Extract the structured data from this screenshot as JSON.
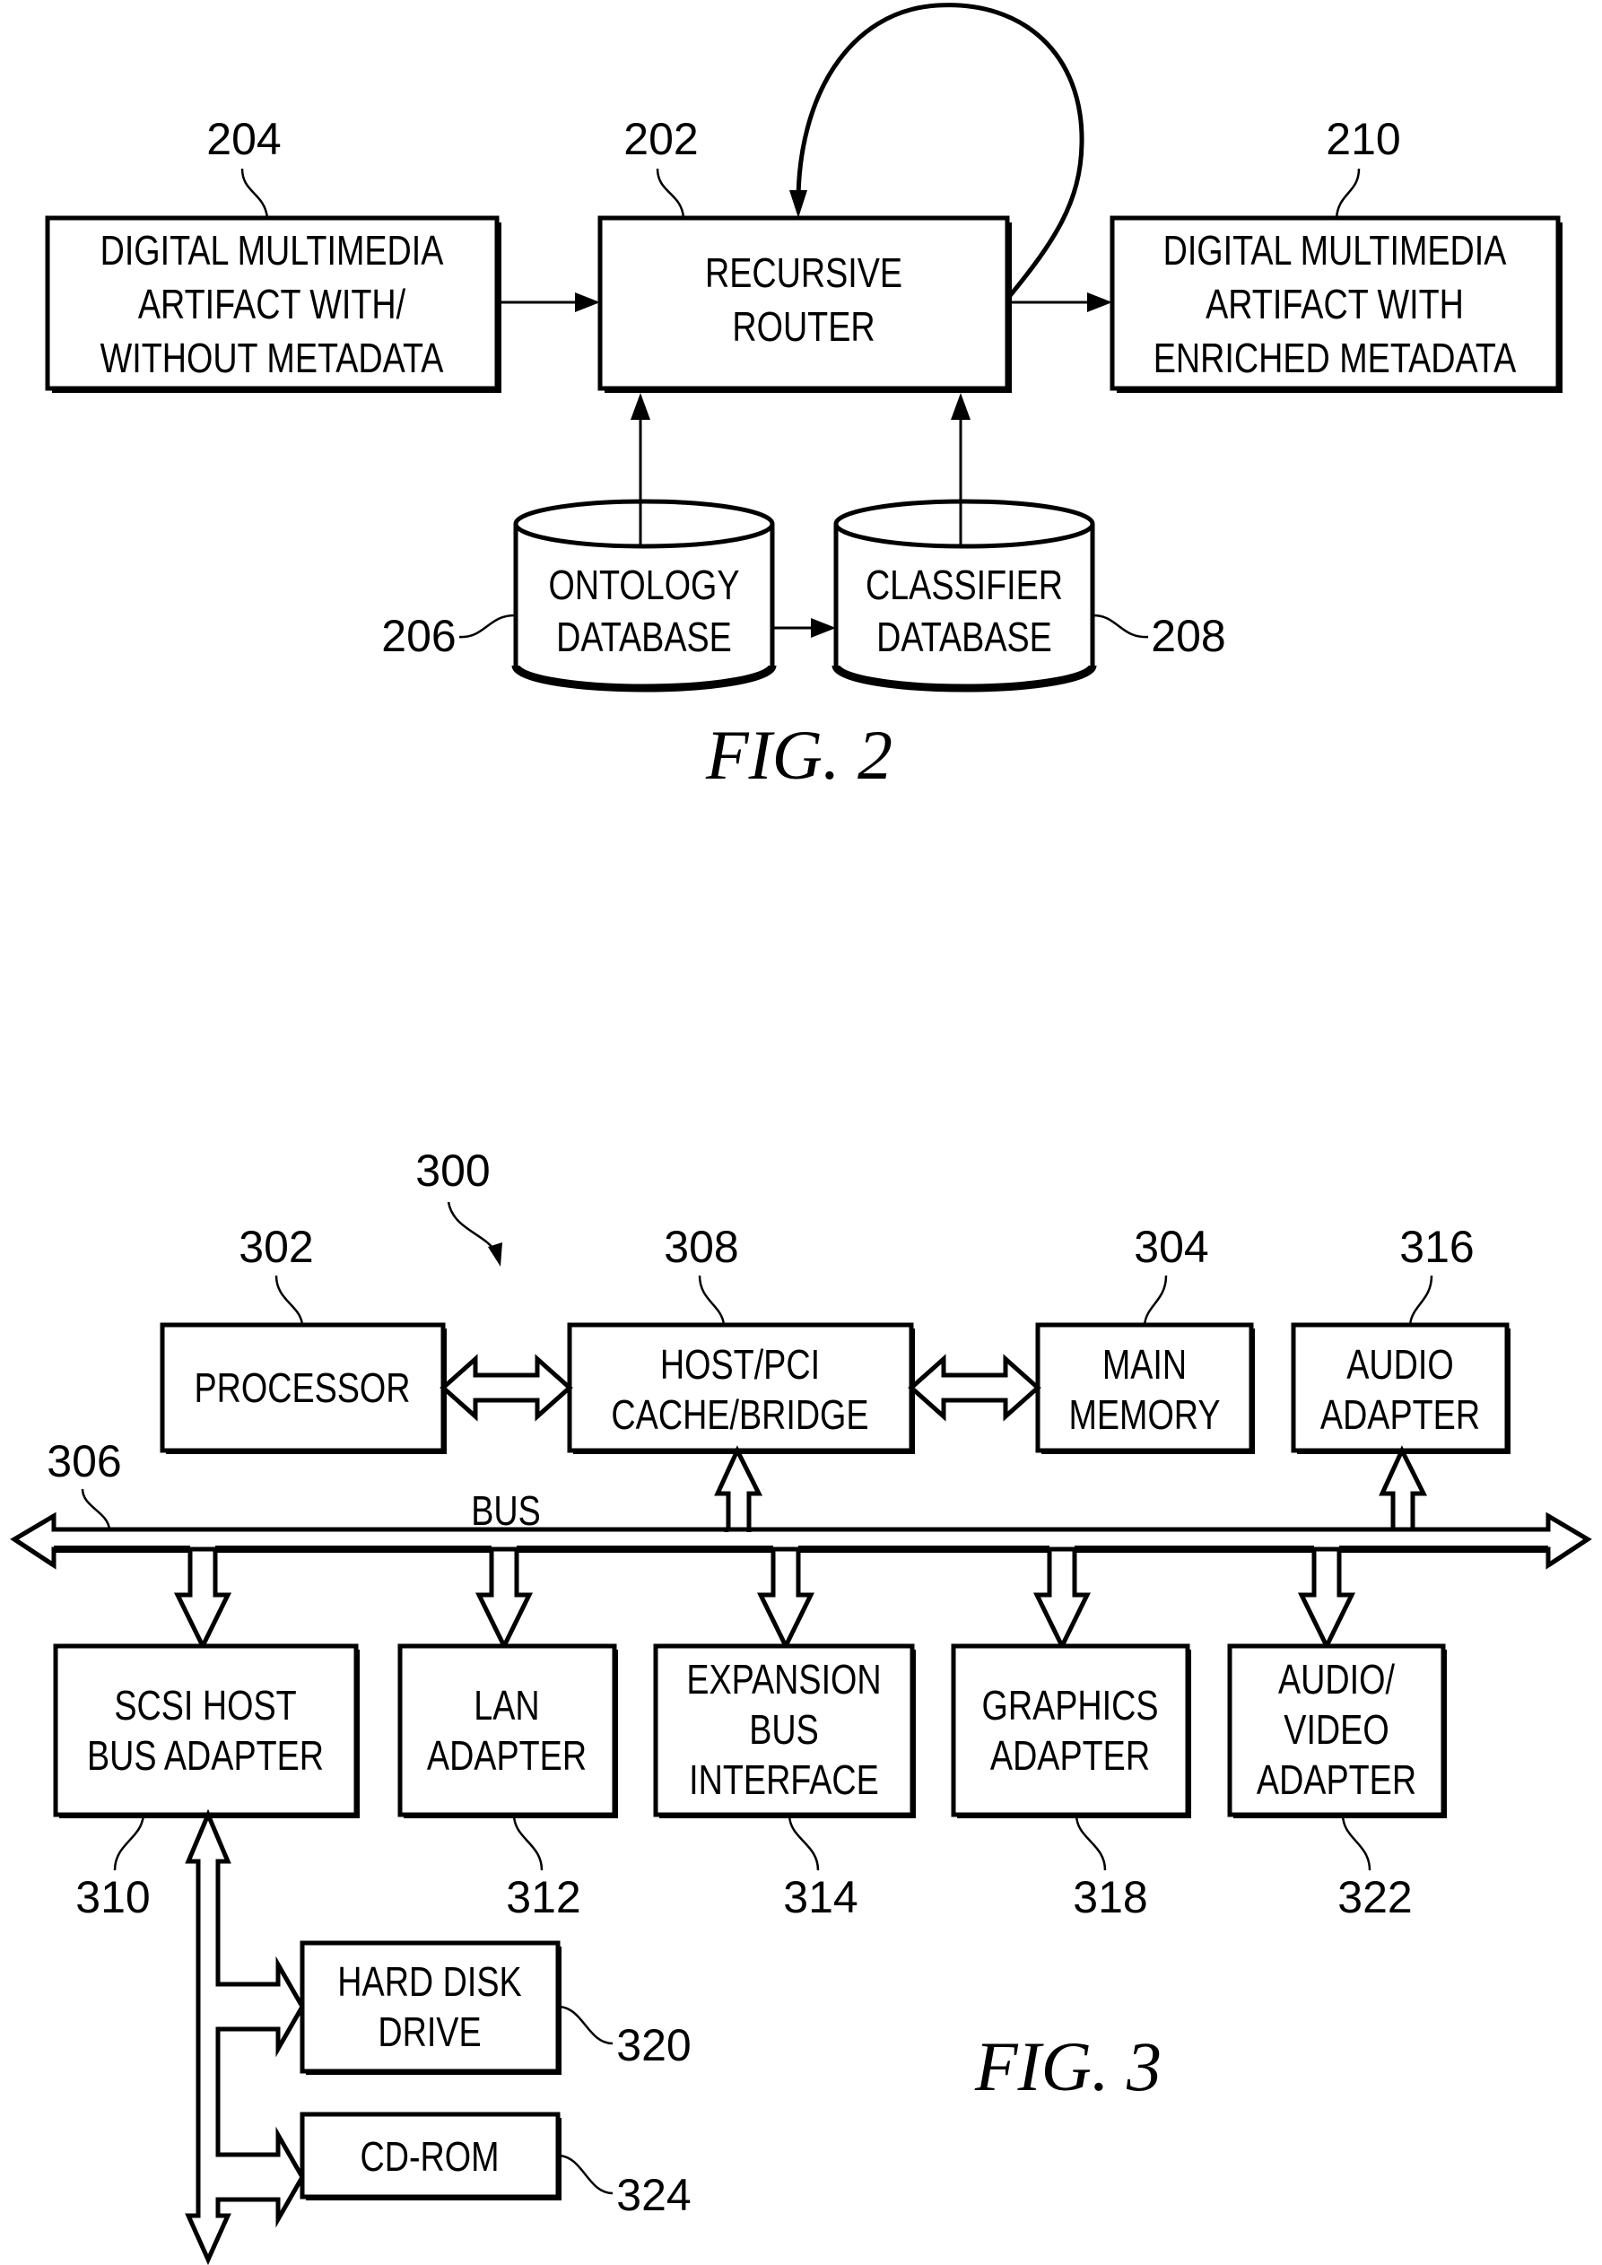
{
  "fig2": {
    "caption": "FIG. 2",
    "nodes": {
      "input_artifact": {
        "ref": "204",
        "lines": [
          "DIGITAL MULTIMEDIA",
          "ARTIFACT WITH/",
          "WITHOUT METADATA"
        ]
      },
      "recursive_router": {
        "ref": "202",
        "lines": [
          "RECURSIVE",
          "ROUTER"
        ]
      },
      "output_artifact": {
        "ref": "210",
        "lines": [
          "DIGITAL MULTIMEDIA",
          "ARTIFACT WITH",
          "ENRICHED METADATA"
        ]
      },
      "ontology_db": {
        "ref": "206",
        "lines": [
          "ONTOLOGY",
          "DATABASE"
        ]
      },
      "classifier_db": {
        "ref": "208",
        "lines": [
          "CLASSIFIER",
          "DATABASE"
        ]
      }
    },
    "edges": [
      {
        "from": "input_artifact",
        "to": "recursive_router"
      },
      {
        "from": "recursive_router",
        "to": "output_artifact"
      },
      {
        "from": "recursive_router",
        "to": "recursive_router"
      },
      {
        "from": "ontology_db",
        "to": "recursive_router"
      },
      {
        "from": "classifier_db",
        "to": "recursive_router"
      },
      {
        "from": "ontology_db",
        "to": "classifier_db"
      }
    ]
  },
  "fig3": {
    "caption": "FIG. 3",
    "system_ref": "300",
    "bus": {
      "ref": "306",
      "label": "BUS"
    },
    "nodes": {
      "processor": {
        "ref": "302",
        "lines": [
          "PROCESSOR"
        ]
      },
      "host_pci": {
        "ref": "308",
        "lines": [
          "HOST/PCI",
          "CACHE/BRIDGE"
        ]
      },
      "main_memory": {
        "ref": "304",
        "lines": [
          "MAIN",
          "MEMORY"
        ]
      },
      "audio_adapter": {
        "ref": "316",
        "lines": [
          "AUDIO",
          "ADAPTER"
        ]
      },
      "scsi": {
        "ref": "310",
        "lines": [
          "SCSI HOST",
          "BUS ADAPTER"
        ]
      },
      "lan": {
        "ref": "312",
        "lines": [
          "LAN",
          "ADAPTER"
        ]
      },
      "expansion": {
        "ref": "314",
        "lines": [
          "EXPANSION",
          "BUS",
          "INTERFACE"
        ]
      },
      "graphics": {
        "ref": "318",
        "lines": [
          "GRAPHICS",
          "ADAPTER"
        ]
      },
      "av_adapter": {
        "ref": "322",
        "lines": [
          "AUDIO/",
          "VIDEO",
          "ADAPTER"
        ]
      },
      "hard_disk": {
        "ref": "320",
        "lines": [
          "HARD DISK",
          "DRIVE"
        ]
      },
      "cdrom": {
        "ref": "324",
        "lines": [
          "CD-ROM"
        ]
      }
    },
    "edges": [
      {
        "from": "processor",
        "to": "host_pci",
        "type": "bidirectional"
      },
      {
        "from": "host_pci",
        "to": "main_memory",
        "type": "bidirectional"
      },
      {
        "from": "bus",
        "to": "host_pci"
      },
      {
        "from": "bus",
        "to": "audio_adapter"
      },
      {
        "from": "bus",
        "to": "scsi"
      },
      {
        "from": "bus",
        "to": "lan"
      },
      {
        "from": "bus",
        "to": "expansion"
      },
      {
        "from": "bus",
        "to": "graphics"
      },
      {
        "from": "bus",
        "to": "av_adapter"
      },
      {
        "from": "scsi",
        "to": "hard_disk"
      },
      {
        "from": "scsi",
        "to": "cdrom"
      }
    ]
  }
}
